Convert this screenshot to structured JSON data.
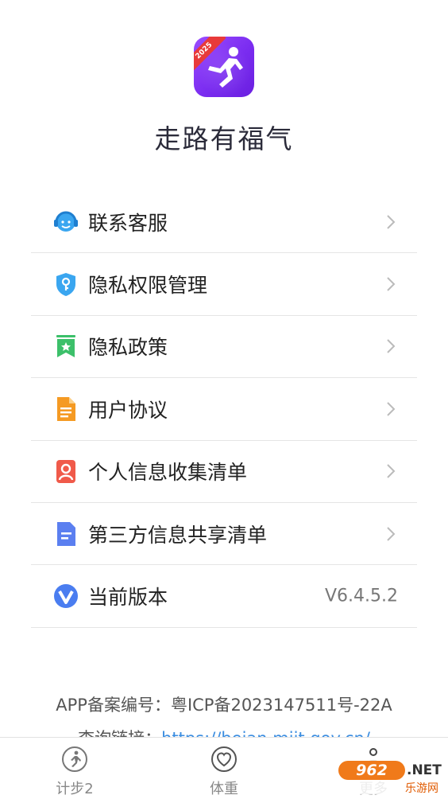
{
  "app": {
    "title": "走路有福气",
    "logo_badge": "2025",
    "brand_color": "#8a3cf5"
  },
  "menu": {
    "items": [
      {
        "label": "联系客服",
        "icon": "headset-icon",
        "color": "#3aa6f0"
      },
      {
        "label": "隐私权限管理",
        "icon": "shield-key-icon",
        "color": "#3aa6f0"
      },
      {
        "label": "隐私政策",
        "icon": "bookmark-star-icon",
        "color": "#3cc06a"
      },
      {
        "label": "用户协议",
        "icon": "document-icon",
        "color": "#f59a23"
      },
      {
        "label": "个人信息收集清单",
        "icon": "person-card-icon",
        "color": "#f05a4a"
      },
      {
        "label": "第三方信息共享清单",
        "icon": "file-lines-icon",
        "color": "#5b7ff0"
      },
      {
        "label": "当前版本",
        "icon": "v-logo-icon",
        "color": "#4a7df0",
        "value": "V6.4.5.2"
      }
    ]
  },
  "footer": {
    "record_label": "APP备案编号：粤ICP备2023147511号-22A",
    "query_prefix": "查询链接：",
    "query_link": "https://beian.miit.gov.cn/"
  },
  "tabbar": {
    "tabs": [
      {
        "label": "计步2",
        "icon": "runner-circle-icon"
      },
      {
        "label": "体重",
        "icon": "heart-circle-icon"
      },
      {
        "label": "更多",
        "icon": "more-icon"
      }
    ]
  },
  "watermark": {
    "badge": "962",
    "net": ".NET",
    "sub": "乐游网"
  }
}
